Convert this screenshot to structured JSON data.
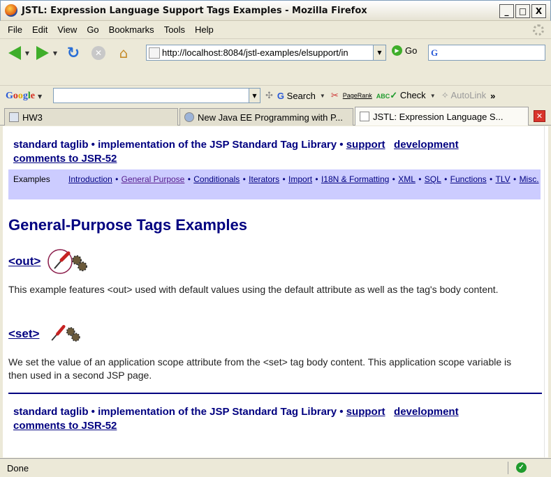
{
  "window": {
    "title": "JSTL: Expression Language Support Tags Examples - Mozilla Firefox",
    "minimize": "_",
    "maximize": "□",
    "close": "X"
  },
  "menu": [
    "File",
    "Edit",
    "View",
    "Go",
    "Bookmarks",
    "Tools",
    "Help"
  ],
  "nav": {
    "url": "http://localhost:8084/jstl-examples/elsupport/in",
    "go_label": "Go",
    "search_value": ""
  },
  "google_toolbar": {
    "logo": "Google",
    "search_label": "Search",
    "pagerank_label": "PageRank",
    "check_label": "Check",
    "autolink_label": "AutoLink",
    "more": "»",
    "spell_label": "ABC"
  },
  "tabs": [
    {
      "label": "HW3",
      "active": false
    },
    {
      "label": "New Java EE Programming with P...",
      "active": false
    },
    {
      "label": "JSTL: Expression Language S...",
      "active": true
    }
  ],
  "page": {
    "header": {
      "text": "standard taglib • implementation of the JSP Standard Tag Library • ",
      "support": "support",
      "development": "development",
      "comments": "comments to JSR-52"
    },
    "navbox": {
      "label": "Examples",
      "links": [
        {
          "text": "Introduction",
          "visited": false
        },
        {
          "text": "General Purpose",
          "visited": true
        },
        {
          "text": "Conditionals",
          "visited": false
        },
        {
          "text": "Iterators",
          "visited": false
        },
        {
          "text": "Import",
          "visited": false
        },
        {
          "text": "I18N & Formatting",
          "visited": false
        },
        {
          "text": "XML",
          "visited": false
        },
        {
          "text": "SQL",
          "visited": false
        },
        {
          "text": "Functions",
          "visited": false
        },
        {
          "text": "TLV",
          "visited": false
        },
        {
          "text": "Misc.",
          "visited": false
        }
      ]
    },
    "title": "General-Purpose Tags Examples",
    "sections": [
      {
        "tag": "<out>",
        "description": "This example features <out> used with default values using the default attribute as well as the tag's body content."
      },
      {
        "tag": "<set>",
        "description": "We set the value of an application scope attribute from the <set> tag body content. This application scope variable is then used in a second JSP page."
      }
    ]
  },
  "status": {
    "text": "Done"
  }
}
